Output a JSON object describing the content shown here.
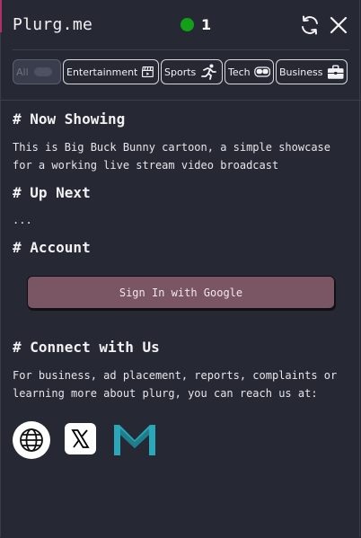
{
  "header": {
    "title": "Plurg.me",
    "viewer_count": "1",
    "live_color": "#12a018",
    "refresh_icon": "refresh-icon",
    "close_icon": "close-icon"
  },
  "categories": [
    {
      "label": "All",
      "icon": "toggle-icon",
      "active": true
    },
    {
      "label": "Entertainment",
      "icon": "clapperboard-icon",
      "active": false
    },
    {
      "label": "Sports",
      "icon": "running-person-icon",
      "active": false
    },
    {
      "label": "Tech",
      "icon": "vr-headset-icon",
      "active": false
    },
    {
      "label": "Business",
      "icon": "briefcase-icon",
      "active": false
    }
  ],
  "now_showing": {
    "heading": "# Now Showing",
    "text": "This is Big Buck Bunny cartoon, a simple showcase for a working live stream video broadcast"
  },
  "up_next": {
    "heading": "# Up Next",
    "text": "..."
  },
  "account": {
    "heading": "# Account",
    "signin_label": "Sign In with Google",
    "signin_color": "#7a5563"
  },
  "connect": {
    "heading": "# Connect with Us",
    "text": "For business, ad placement, reports, complaints or learning more about plurg, you can reach us at:",
    "links": [
      {
        "icon": "globe-icon"
      },
      {
        "icon": "x-logo-icon"
      },
      {
        "icon": "gmail-icon"
      }
    ]
  }
}
